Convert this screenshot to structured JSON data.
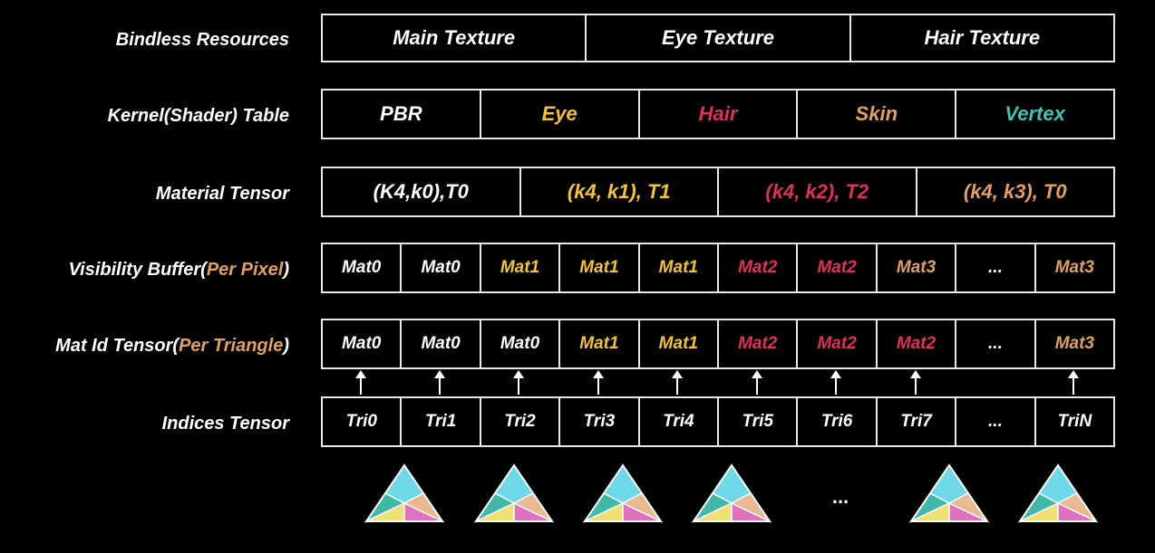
{
  "colors": {
    "white": "#ffffff",
    "yellow": "#f4c430",
    "red": "#e0305a",
    "orange": "#e0a060",
    "teal": "#3cc4b4"
  },
  "rows": [
    {
      "label": "Bindless Resources",
      "cells": [
        {
          "text": "Main Texture",
          "color": "white"
        },
        {
          "text": "Eye Texture",
          "color": "white"
        },
        {
          "text": "Hair Texture",
          "color": "white"
        }
      ]
    },
    {
      "label": "Kernel(Shader) Table",
      "cells": [
        {
          "text": "PBR",
          "color": "white"
        },
        {
          "text": "Eye",
          "color": "yellow"
        },
        {
          "text": "Hair",
          "color": "red"
        },
        {
          "text": "Skin",
          "color": "orange"
        },
        {
          "text": "Vertex",
          "color": "teal"
        }
      ]
    },
    {
      "label": "Material Tensor",
      "cells": [
        {
          "text": "(K4,k0),T0",
          "color": "white"
        },
        {
          "text": "(k4, k1), T1",
          "color": "yellow"
        },
        {
          "text": "(k4, k2), T2",
          "color": "red"
        },
        {
          "text": "(k4, k3), T0",
          "color": "orange"
        }
      ]
    },
    {
      "label_main": "Visibility Buffer(",
      "label_accent": "Per Pixel",
      "label_end": ")",
      "cells": [
        {
          "text": "Mat0",
          "color": "white"
        },
        {
          "text": "Mat0",
          "color": "white"
        },
        {
          "text": "Mat1",
          "color": "yellow"
        },
        {
          "text": "Mat1",
          "color": "yellow"
        },
        {
          "text": "Mat1",
          "color": "yellow"
        },
        {
          "text": "Mat2",
          "color": "red"
        },
        {
          "text": "Mat2",
          "color": "red"
        },
        {
          "text": "Mat3",
          "color": "orange"
        },
        {
          "text": "...",
          "color": "white"
        },
        {
          "text": "Mat3",
          "color": "orange"
        }
      ]
    },
    {
      "label_main": "Mat Id Tensor(",
      "label_accent": "Per Triangle",
      "label_end": ")",
      "cells": [
        {
          "text": "Mat0",
          "color": "white"
        },
        {
          "text": "Mat0",
          "color": "white"
        },
        {
          "text": "Mat0",
          "color": "white"
        },
        {
          "text": "Mat1",
          "color": "yellow"
        },
        {
          "text": "Mat1",
          "color": "yellow"
        },
        {
          "text": "Mat2",
          "color": "red"
        },
        {
          "text": "Mat2",
          "color": "red"
        },
        {
          "text": "Mat2",
          "color": "red"
        },
        {
          "text": "...",
          "color": "white"
        },
        {
          "text": "Mat3",
          "color": "orange"
        }
      ]
    },
    {
      "label": "Indices Tensor",
      "cells": [
        {
          "text": "Tri0",
          "color": "white"
        },
        {
          "text": "Tri1",
          "color": "white"
        },
        {
          "text": "Tri2",
          "color": "white"
        },
        {
          "text": "Tri3",
          "color": "white"
        },
        {
          "text": "Tri4",
          "color": "white"
        },
        {
          "text": "Tri5",
          "color": "white"
        },
        {
          "text": "Tri6",
          "color": "white"
        },
        {
          "text": "Tri7",
          "color": "white"
        },
        {
          "text": "...",
          "color": "white"
        },
        {
          "text": "TriN",
          "color": "white"
        }
      ]
    }
  ],
  "bottom_ellipsis": "...",
  "triangle_colors": {
    "top": "#6fd8e8",
    "left": "#3fb8a8",
    "right": "#e8b890",
    "bottom_left": "#f0e070",
    "bottom_right": "#e070c0",
    "center": "#ffffff"
  }
}
